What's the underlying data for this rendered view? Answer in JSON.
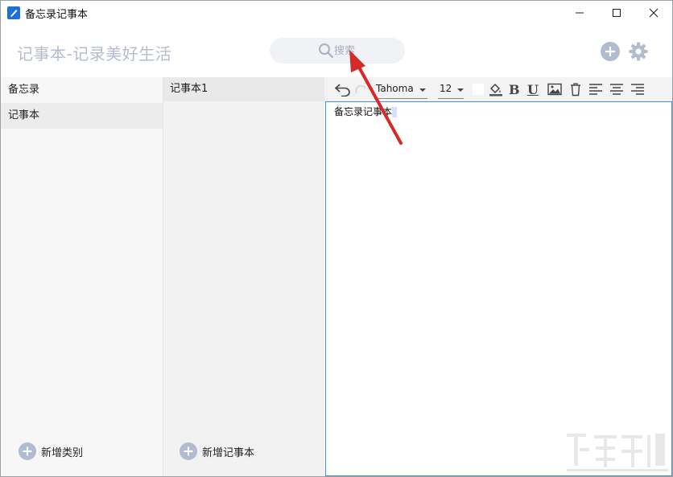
{
  "window": {
    "title": "备忘录记事本"
  },
  "header": {
    "slogan": "记事本-记录美好生活",
    "search_placeholder": "搜索"
  },
  "categories": {
    "heading": "备忘录",
    "items": [
      "记事本"
    ],
    "add_label": "新增类别"
  },
  "notes": {
    "items": [
      "记事本1"
    ],
    "add_label": "新增记事本"
  },
  "toolbar": {
    "font": "Tahoma",
    "size": "12"
  },
  "editor": {
    "content": "备忘录记事本"
  },
  "colors": {
    "accent": "#1e6fd9",
    "header_text": "#b6bdd1",
    "icon_gray": "#b3bbd0",
    "editor_border": "#4a90d9",
    "arrow": "#d42a2a"
  }
}
